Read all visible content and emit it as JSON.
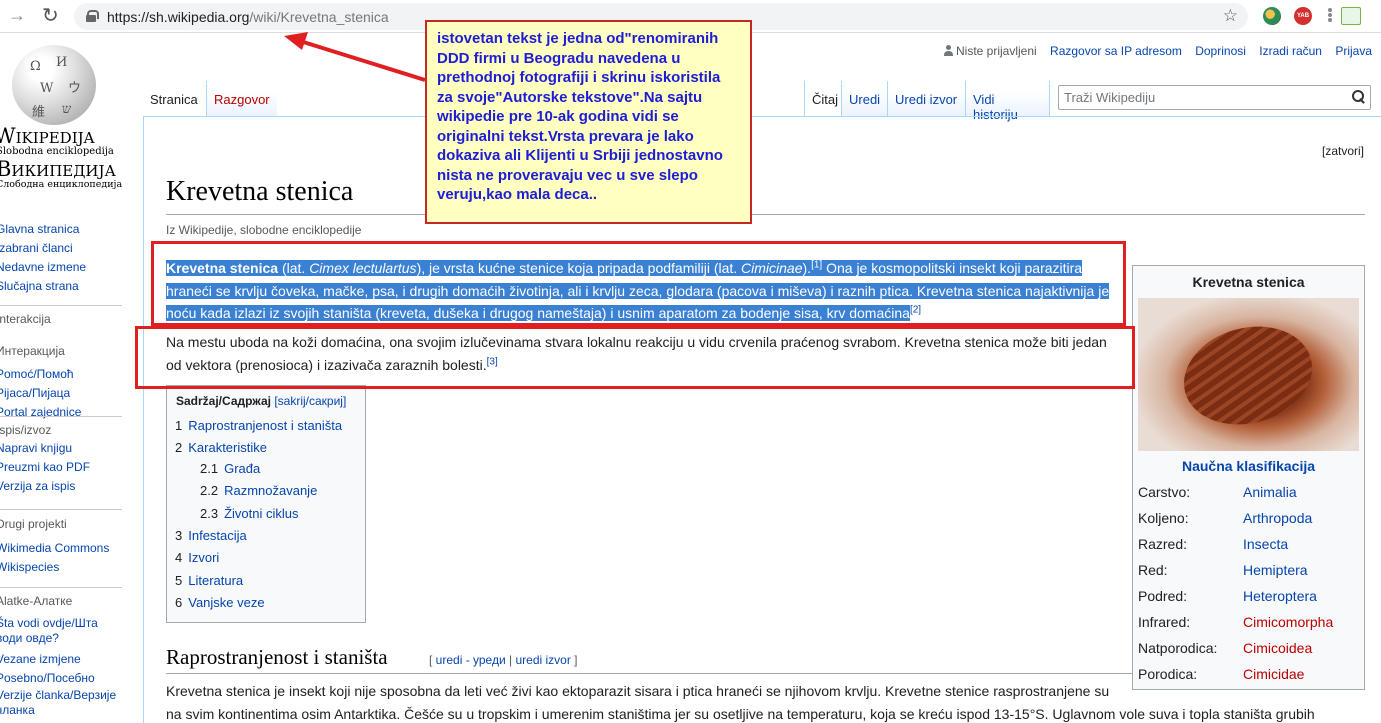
{
  "browser": {
    "url_host": "https://sh.wikipedia.org",
    "url_path": "/wiki/Krevetna_stenica",
    "ext_badge": "YAB"
  },
  "logo": {
    "line1": "Wikipedija",
    "line2": "Slobodna enciklopedija",
    "line3": "Википедија",
    "line4": "Слободна енциклопедија"
  },
  "sidebar": {
    "nav": [
      "Glavna stranica",
      "Izabrani članci",
      "Nedavne izmene",
      "Slučajna strana"
    ],
    "interaction_heading": "Interakcija - Интеракција",
    "interaction_heading_line2": "Интеракција",
    "interaction": [
      "Pomoć/Помоћ",
      "Pijaca/Пијаца",
      "Portal zajednice"
    ],
    "print_heading": "Ispis/izvoz",
    "print": [
      "Napravi knjigu",
      "Preuzmi kao PDF",
      "Verzija za ispis"
    ],
    "projects_heading": "Drugi projekti",
    "projects": [
      "Wikimedia Commons",
      "Wikispecies"
    ],
    "tools_heading": "Alatke-Алатке",
    "tools": [
      "Šta vodi ovdje/Шта",
      "води овде?",
      "Vezane izmjene",
      "Posebno/Посебно",
      "Verzije članka/Верзије",
      "чланка"
    ]
  },
  "personal": {
    "anon": "Niste prijavljeni",
    "links": [
      "Razgovor sa IP adresom",
      "Doprinosi",
      "Izradi račun",
      "Prijava"
    ]
  },
  "tabs": {
    "left": [
      "Stranica",
      "Razgovor"
    ],
    "right": [
      "Čitaj",
      "Uredi",
      "Uredi izvor",
      "Vidi historiju"
    ]
  },
  "search": {
    "placeholder": "Traži Wikipediju"
  },
  "notice": {
    "close": "zatvori"
  },
  "page": {
    "title": "Krevetna stenica",
    "tagline": "Iz Wikipedije, slobodne enciklopedije",
    "p1_bold": "Krevetna stenica",
    "p1_a": " (lat. ",
    "p1_i1": "Cimex lectulartus",
    "p1_b": "), je vrsta kućne stenice koja pripada podfamiliji (lat. ",
    "p1_i2": "Cimicinae",
    "p1_c": ").",
    "p1_ref1": "[1]",
    "p1_d": " Ona je kosmopolitski insekt koji parazitira hraneći se krvlju čoveka, mačke, psa, i drugih domaćih životinja, ali i krvlju zeca, glodara (pacova i miševa) i raznih ptica. Krevetna stenica najaktivnija je noću kada izlazi iz svojih staništa (kreveta, dušeka i drugog nameštaja) i usnim aparatom za bodenje sisa, krv domaćina",
    "p1_ref2": "[2]",
    "p2": "Na mestu uboda na koži domaćina, ona svojim izlučevinama stvara lokalnu reakciju u vidu crvenila praćenog svrabom. Krevetna stenica može biti jedan od vektora (prenosioca) i izazivača zaraznih bolesti.",
    "p2_ref": "[3]",
    "section_title": "Raprostranjenost i staništa",
    "section_edit_open": "[ ",
    "section_edit1": "uredi - уреди",
    "section_edit_sep": " | ",
    "section_edit2": "uredi izvor",
    "section_edit_close": " ]",
    "p3_line1": "Krevetna stenica je insekt koji nije sposobna da leti već živi kao ektoparazit sisara i ptica hraneći se njihovom krvlju. Krevetne stenice rasprostranjene su",
    "p3_line2": "na svim kontinentima osim Antarktika. Češće su u tropskim i umerenim staništima jer su osetljive na temperaturu, koja se kreću ispod 13-15°S. Uglavnom vole suva i topla staništa grubih"
  },
  "toc": {
    "title": "Sadržaj/Садржај",
    "toggle": "[sakrij/сакриј]",
    "items": [
      {
        "num": "1",
        "label": "Raprostranjenost i staništa"
      },
      {
        "num": "2",
        "label": "Karakteristike"
      },
      {
        "num": "2.1",
        "label": "Građa"
      },
      {
        "num": "2.2",
        "label": "Razmnožavanje"
      },
      {
        "num": "2.3",
        "label": "Životni ciklus"
      },
      {
        "num": "3",
        "label": "Infestacija"
      },
      {
        "num": "4",
        "label": "Izvori"
      },
      {
        "num": "5",
        "label": "Literatura"
      },
      {
        "num": "6",
        "label": "Vanjske veze"
      }
    ]
  },
  "infobox": {
    "title": "Krevetna stenica",
    "subtitle": "Naučna klasifikacija",
    "rows": [
      {
        "k": "Carstvo:",
        "v": "Animalia"
      },
      {
        "k": "Koljeno:",
        "v": "Arthropoda"
      },
      {
        "k": "Razred:",
        "v": "Insecta"
      },
      {
        "k": "Red:",
        "v": "Hemiptera"
      },
      {
        "k": "Podred:",
        "v": "Heteroptera"
      },
      {
        "k": "Infrared:",
        "v": "Cimicomorpha"
      },
      {
        "k": "Natporodica:",
        "v": "Cimicoidea"
      },
      {
        "k": "Porodica:",
        "v": "Cimicidae"
      }
    ]
  },
  "annotation": {
    "text": "istovetan tekst je jedna od\"renomiranih DDD firmi u Beogradu navedena u prethodnoj fotografiji i skrinu iskoristila za svoje\"Autorske tekstove\".Na sajtu wikipedie pre 10-ak godina vidi se originalni tekst.Vrsta prevara je lako dokaziva ali Klijenti u Srbiji jednostavno nista ne proveravaju vec u sve slepo veruju,kao mala deca..",
    "border_color": "#c62828",
    "text_color": "#1d1dd8"
  },
  "colors": {
    "link": "#0645ad",
    "redlink": "#ba0000",
    "highlight": "#3a80d3"
  }
}
